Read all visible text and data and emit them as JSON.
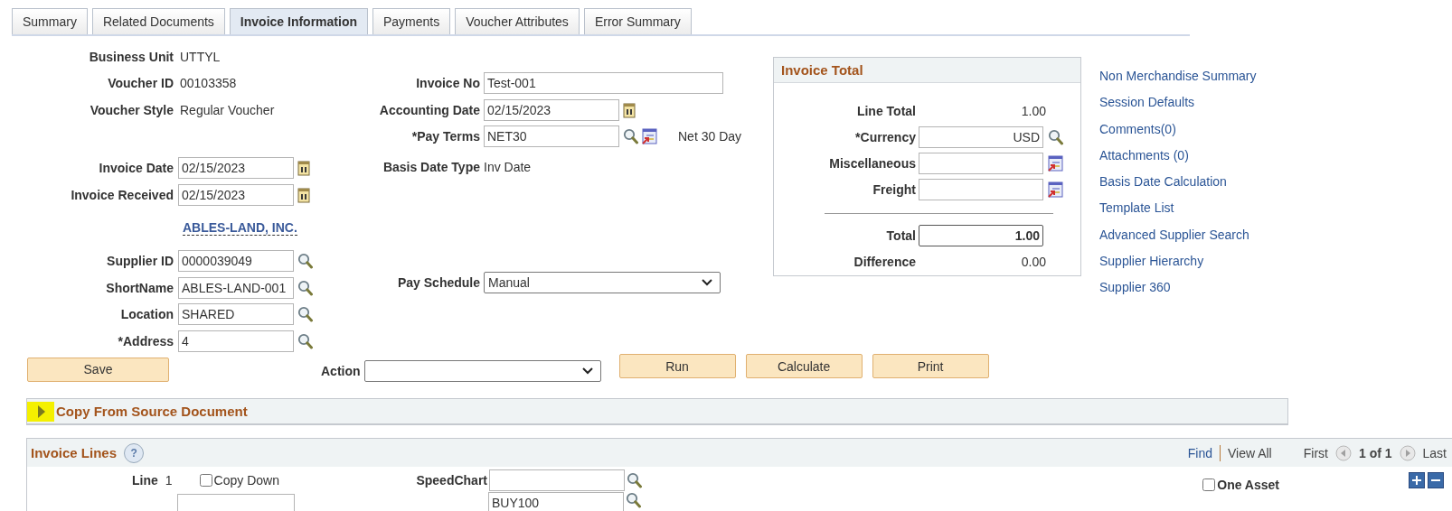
{
  "tabs": [
    {
      "label": "Summary",
      "selected": false
    },
    {
      "label": "Related Documents",
      "selected": false
    },
    {
      "label": "Invoice Information",
      "selected": true
    },
    {
      "label": "Payments",
      "selected": false
    },
    {
      "label": "Voucher Attributes",
      "selected": false
    },
    {
      "label": "Error Summary",
      "selected": false
    }
  ],
  "voucher_info": [
    {
      "label": "Business Unit",
      "value": "UTTYL"
    },
    {
      "label": "Voucher ID",
      "value": "00103358"
    },
    {
      "label": "Voucher Style",
      "value": "Regular Voucher"
    }
  ],
  "invoice_dates": [
    {
      "label": "Invoice Date",
      "value": "02/15/2023"
    },
    {
      "label": "Invoice Received",
      "value": "02/15/2023"
    }
  ],
  "supplier_name": "ABLES-LAND, INC.",
  "supplier_fields": [
    {
      "label": "Supplier ID",
      "value": "0000039049"
    },
    {
      "label": "ShortName",
      "value": "ABLES-LAND-001"
    },
    {
      "label": "Location",
      "value": "SHARED"
    },
    {
      "label": "*Address",
      "value": "4"
    }
  ],
  "save_button": "Save",
  "invoice_fields": [
    {
      "kind": "text",
      "label": "Invoice No",
      "value": "Test-001"
    },
    {
      "kind": "date",
      "label": "Accounting Date",
      "value": "02/15/2023"
    },
    {
      "kind": "lookup",
      "label": "*Pay Terms",
      "value": "NET30",
      "description": "Net 30 Day"
    },
    {
      "kind": "display",
      "label": "Basis Date Type",
      "value": "Inv Date"
    }
  ],
  "pay_schedule": {
    "label": "Pay Schedule",
    "value": "Manual"
  },
  "action": {
    "label": "Action"
  },
  "action_buttons": [
    "Run",
    "Calculate",
    "Print"
  ],
  "invoice_total": {
    "title": "Invoice Total",
    "amounts": [
      {
        "kind": "display",
        "label": "Line Total",
        "value": "1.00"
      },
      {
        "kind": "lookup",
        "label": "*Currency",
        "value": "USD"
      },
      {
        "kind": "detail",
        "label": "Miscellaneous"
      },
      {
        "kind": "detail",
        "label": "Freight"
      }
    ],
    "totals": [
      {
        "kind": "field",
        "label": "Total",
        "value": "1.00"
      },
      {
        "kind": "display",
        "label": "Difference",
        "value": "0.00"
      }
    ]
  },
  "links": [
    "Non Merchandise Summary",
    "Session Defaults",
    "Comments(0)",
    "Attachments (0)",
    "Basis Date Calculation",
    "Template List",
    "Advanced Supplier Search",
    "Supplier Hierarchy",
    "Supplier 360"
  ],
  "copy_section": {
    "title": "Copy From Source Document",
    "expanded": false
  },
  "invoice_lines": {
    "title": "Invoice Lines",
    "help": "?",
    "nav": {
      "find": "Find",
      "view_all": "View All",
      "first": "First",
      "count": "1 of 1",
      "last": "Last"
    },
    "line": {
      "label": "Line",
      "number": "1"
    },
    "copy_down": {
      "label": "Copy Down",
      "checked": false
    },
    "speedchart": {
      "label": "SpeedChart"
    },
    "next_row_value": "BUY100",
    "one_asset": {
      "label": "One Asset",
      "checked": false
    }
  }
}
